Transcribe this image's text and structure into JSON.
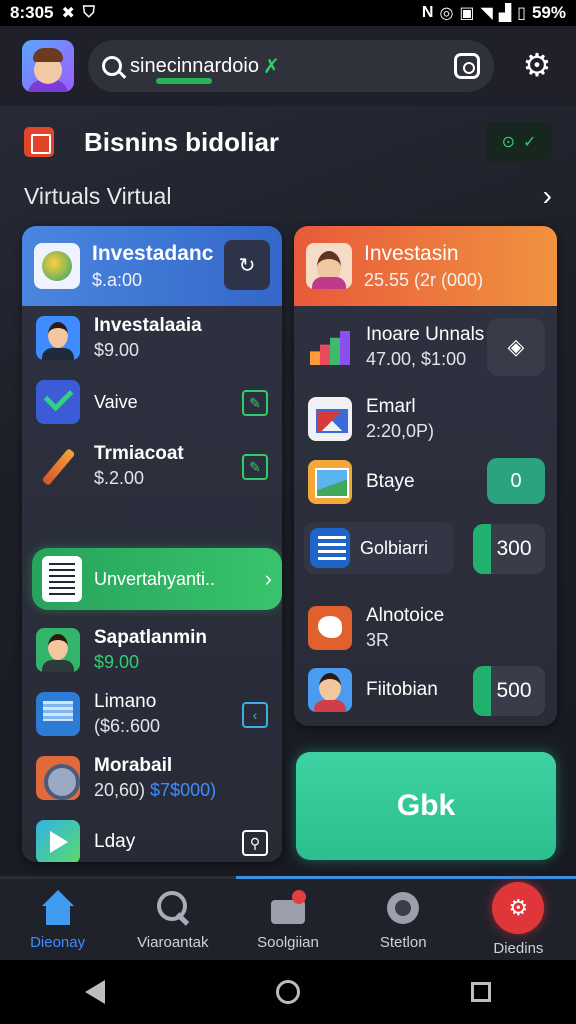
{
  "status_bar": {
    "time": "8:305",
    "battery": "59%"
  },
  "top_bar": {
    "search_text": "sinecinnardoio",
    "search_mark": "✗"
  },
  "section": {
    "title": "Bisnins bidoliar",
    "subtitle": "Virtuals Virtual"
  },
  "left_card": {
    "title": "Investadanc",
    "value": "$.a:00",
    "rows": [
      {
        "title": "Investalaaia",
        "value": "$9.00"
      },
      {
        "title": "Vaive",
        "value": ""
      },
      {
        "title": "Trmiacoat",
        "value": "$.2.00"
      }
    ],
    "highlight": "Unvertahyanti..",
    "rows2": [
      {
        "title": "Sapatlanmin",
        "value": "$9.00"
      },
      {
        "title": "Limano",
        "value": "($6:.600"
      },
      {
        "title": "Morabail",
        "value": "20,60) ",
        "value_blue": "$7$000)"
      },
      {
        "title": "Lday",
        "value": ""
      }
    ]
  },
  "right_card": {
    "title": "Investasin",
    "value": "25.55 (2r (000)",
    "rows": [
      {
        "title": "Inoare Unnals",
        "value": "47.00, $1:00"
      },
      {
        "title": "Emarl",
        "value": "2:20,0P)"
      },
      {
        "title": "Btaye",
        "value": "",
        "button": "0"
      },
      {
        "title": "Golbiarri",
        "count": "300",
        "fill": 0.25
      },
      {
        "title": "Alnotoice",
        "value": "3R"
      },
      {
        "title": "Fiitobian",
        "count": "500",
        "fill": 0.25
      }
    ]
  },
  "gbk_button": "Gbk",
  "bottom_nav": [
    {
      "label": "Dieonay"
    },
    {
      "label": "Viaroantak"
    },
    {
      "label": "Soolgiian"
    },
    {
      "label": "Stetlon"
    },
    {
      "label": "Diedins"
    }
  ]
}
